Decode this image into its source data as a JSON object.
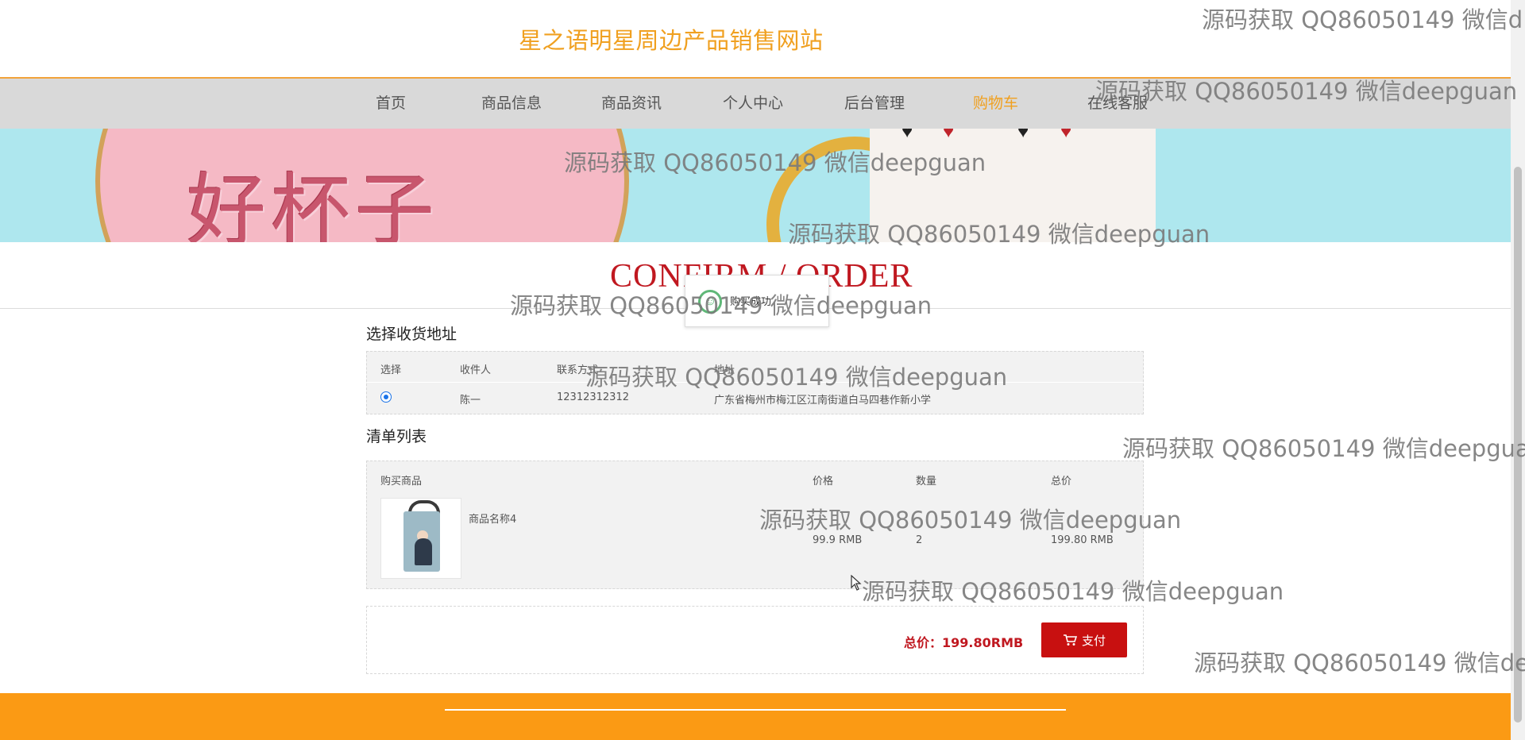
{
  "site": {
    "title": "星之语明星周边产品销售网站"
  },
  "nav": {
    "items": [
      {
        "label": "首页",
        "active": false
      },
      {
        "label": "商品信息",
        "active": false
      },
      {
        "label": "商品资讯",
        "active": false
      },
      {
        "label": "个人中心",
        "active": false
      },
      {
        "label": "后台管理",
        "active": false
      },
      {
        "label": "购物车",
        "active": true
      },
      {
        "label": "在线客服",
        "active": false
      }
    ]
  },
  "banner": {
    "text": "好杯子"
  },
  "confirm": {
    "title": "CONFIRM / ORDER"
  },
  "toast": {
    "text": "购买成功"
  },
  "address": {
    "section_title": "选择收货地址",
    "headers": [
      "选择",
      "收件人",
      "联系方式",
      "地址"
    ],
    "rows": [
      {
        "selected": true,
        "name": "陈一",
        "phone": "12312312312",
        "address": "广东省梅州市梅江区江南街道白马四巷作新小学"
      }
    ]
  },
  "order_list": {
    "section_title": "清单列表",
    "headers": [
      "购买商品",
      "价格",
      "数量",
      "总价"
    ],
    "items": [
      {
        "name": "商品名称4",
        "price": "99.9 RMB",
        "quantity": "2",
        "total": "199.80 RMB",
        "image_icon": "tote-bag-image"
      }
    ]
  },
  "summary": {
    "total_label": "总价：199.80RMB",
    "pay_label": "支付"
  },
  "watermark": {
    "text_full": "源码获取 QQ86050149 微信deepguan",
    "text_cut1": "源码获取 QQ86050149 微信d",
    "text_cut2": "源码获取 QQ86050149 微信deepgua",
    "text_cut3": "源码获取 QQ86050149 微信de"
  },
  "colors": {
    "accent": "#f0a020",
    "nav_bg": "#d9d9d9",
    "price_red": "#c01820",
    "pay_button": "#c81010",
    "footer": "#fb9a14"
  }
}
